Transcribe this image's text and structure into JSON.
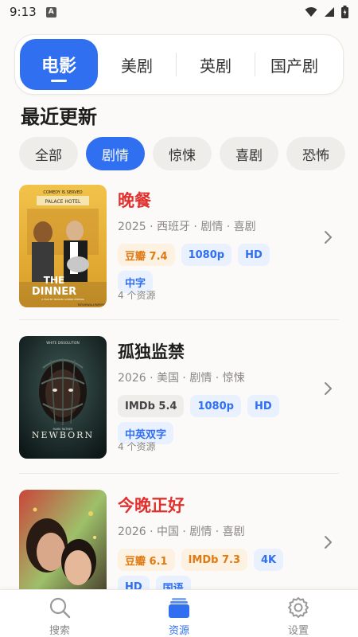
{
  "status": {
    "time": "9:13",
    "app_badge": "A"
  },
  "tabs": [
    {
      "label": "电影",
      "active": true
    },
    {
      "label": "美剧",
      "active": false
    },
    {
      "label": "英剧",
      "active": false
    },
    {
      "label": "国产剧",
      "active": false
    }
  ],
  "section": {
    "title": "最近更新"
  },
  "chips": [
    {
      "label": "全部",
      "active": false
    },
    {
      "label": "剧情",
      "active": true
    },
    {
      "label": "惊悚",
      "active": false
    },
    {
      "label": "喜剧",
      "active": false
    },
    {
      "label": "恐怖",
      "active": false
    }
  ],
  "items": [
    {
      "title": "晚餐",
      "meta": "2025 · 西班牙 · 剧情 · 喜剧",
      "tags": [
        {
          "text": "豆瓣 7.4",
          "kind": "douban"
        },
        {
          "text": "1080p",
          "kind": "blue"
        },
        {
          "text": "HD",
          "kind": "blue"
        },
        {
          "text": "中字",
          "kind": "blue"
        }
      ],
      "sources": "4 个资源",
      "poster": {
        "top_text": "COMEDY IS SERVED",
        "hotel": "PALACE HOTEL",
        "line1": "THE",
        "line2": "DINNER",
        "credit": "A FILM BY MANUEL GÓMEZ PEREIRA",
        "footer": "MOVIEWALLPAPERS"
      }
    },
    {
      "title": "孤独监禁",
      "meta": "2026 · 美国 · 剧情 · 惊悚",
      "tags": [
        {
          "text": "IMDb 5.4",
          "kind": "imdb"
        },
        {
          "text": "1080p",
          "kind": "blue"
        },
        {
          "text": "HD",
          "kind": "blue"
        },
        {
          "text": "中英双字",
          "kind": "blue"
        }
      ],
      "sources": "4 个资源",
      "poster": {
        "top_text": "WHITE DISSOLUTION",
        "title": "NEWBORN",
        "sub": "MARK RATNER"
      }
    },
    {
      "title": "今晚正好",
      "meta": "2026 · 中国 · 剧情 · 喜剧",
      "tags": [
        {
          "text": "豆瓣 6.1",
          "kind": "douban"
        },
        {
          "text": "IMDb 7.3",
          "kind": "imdb-o"
        },
        {
          "text": "4K",
          "kind": "blue"
        },
        {
          "text": "HD",
          "kind": "blue"
        },
        {
          "text": "国语",
          "kind": "blue"
        }
      ],
      "sources": ""
    }
  ],
  "nav": [
    {
      "label": "搜索",
      "icon": "search-icon",
      "active": false
    },
    {
      "label": "资源",
      "icon": "stack-icon",
      "active": true
    },
    {
      "label": "设置",
      "icon": "gear-icon",
      "active": false
    }
  ],
  "colors": {
    "accent": "#2f6ff0",
    "title_red": "#e0312e",
    "douban": "#e07a12"
  }
}
